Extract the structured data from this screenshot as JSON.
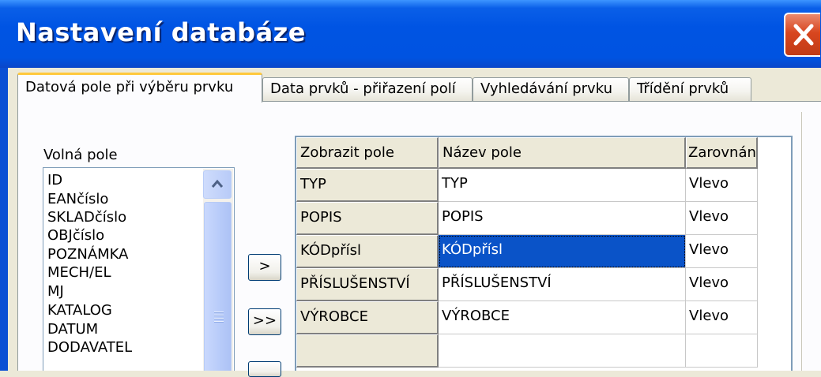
{
  "window": {
    "title": "Nastavení databáze"
  },
  "tabs": [
    {
      "label": "Datová pole při výběru prvku"
    },
    {
      "label": "Data prvků - přiřazení polí"
    },
    {
      "label": "Vyhledávání prvku"
    },
    {
      "label": "Třídění prvků"
    }
  ],
  "free_fields": {
    "label": "Volná pole",
    "items": [
      "ID",
      "EANčíslo",
      "SKLADčíslo",
      "OBJčíslo",
      "POZNÁMKA",
      "MECH/EL",
      "MJ",
      "KATALOG",
      "DATUM",
      "DODAVATEL"
    ]
  },
  "buttons": {
    "add": ">",
    "add_all": ">>"
  },
  "grid": {
    "headers": [
      "Zobrazit pole",
      "Název pole",
      "Zarovnání"
    ],
    "rows": [
      [
        "TYP",
        "TYP",
        "Vlevo"
      ],
      [
        "POPIS",
        "POPIS",
        "Vlevo"
      ],
      [
        "KÓDpřísl",
        "KÓDpřísl",
        "Vlevo"
      ],
      [
        "PŘÍSLUŠENSTVÍ",
        "PŘÍSLUŠENSTVÍ",
        "Vlevo"
      ],
      [
        "VÝROBCE",
        "VÝROBCE",
        "Vlevo"
      ],
      [
        "",
        "",
        ""
      ]
    ]
  }
}
